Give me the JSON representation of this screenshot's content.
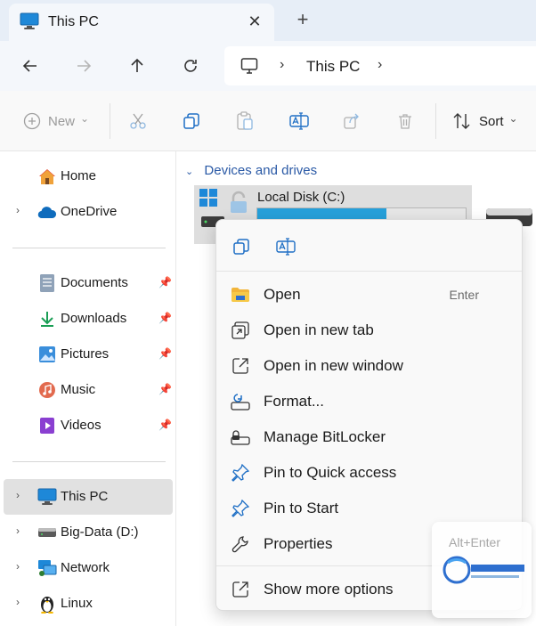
{
  "tab": {
    "title": "This PC",
    "close_glyph": "✕",
    "new_tab_glyph": "+"
  },
  "address": {
    "location": "This PC",
    "separator": "›"
  },
  "toolbar": {
    "new_label": "New",
    "sort_label": "Sort",
    "caret": "⌄"
  },
  "sidebar": {
    "expand_glyph": "›",
    "pin_glyph": "📌",
    "items": [
      {
        "label": "Home"
      },
      {
        "label": "OneDrive"
      },
      {
        "label": "Documents"
      },
      {
        "label": "Downloads"
      },
      {
        "label": "Pictures"
      },
      {
        "label": "Music"
      },
      {
        "label": "Videos"
      },
      {
        "label": "This PC"
      },
      {
        "label": "Big-Data (D:)"
      },
      {
        "label": "Network"
      },
      {
        "label": "Linux"
      }
    ]
  },
  "main": {
    "section_chevron": "⌄",
    "section_title": "Devices and drives",
    "drive": {
      "name": "Local Disk (C:)",
      "used_fraction": 0.62
    }
  },
  "context_menu": {
    "items": [
      {
        "label": "Open",
        "shortcut": "Enter",
        "icon": "folder-icon"
      },
      {
        "label": "Open in new tab",
        "icon": "new-tab-icon"
      },
      {
        "label": "Open in new window",
        "icon": "new-window-icon"
      },
      {
        "label": "Format...",
        "icon": "format-icon"
      },
      {
        "label": "Manage BitLocker",
        "icon": "bitlocker-icon"
      },
      {
        "label": "Pin to Quick access",
        "icon": "pin-icon"
      },
      {
        "label": "Pin to Start",
        "icon": "pin-icon"
      },
      {
        "label": "Properties",
        "icon": "wrench-icon"
      },
      {
        "label": "Show more options",
        "icon": "more-options-icon"
      }
    ],
    "properties_shortcut": "Alt+Enter"
  },
  "colors": {
    "accent": "#2b5aa6",
    "drive_fill": "#26a0da",
    "selected": "#e1e1e1"
  }
}
